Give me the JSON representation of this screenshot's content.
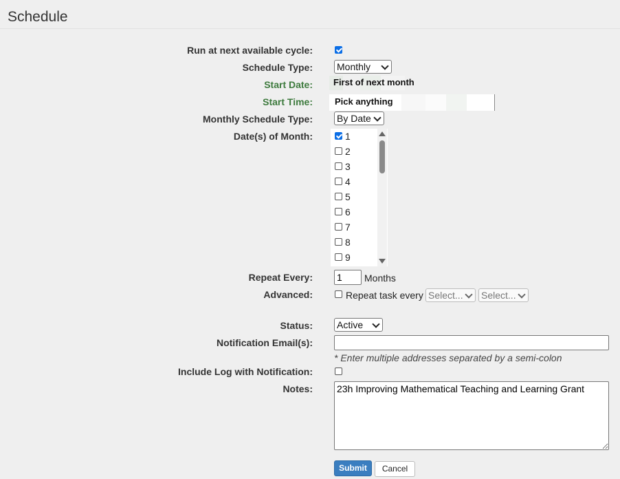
{
  "page": {
    "title": "Schedule"
  },
  "form": {
    "run_next": {
      "label": "Run at next available cycle:",
      "checked": true
    },
    "schedule_type": {
      "label": "Schedule Type:",
      "value": "Monthly"
    },
    "start_date": {
      "label": "Start Date:",
      "value": "First of next month"
    },
    "start_time": {
      "label": "Start Time:",
      "value": "Pick anything"
    },
    "monthly_schedule_type": {
      "label": "Monthly Schedule Type:",
      "value": "By Date"
    },
    "dates_of_month": {
      "label": "Date(s) of Month:",
      "items": [
        {
          "label": "1",
          "checked": true
        },
        {
          "label": "2",
          "checked": false
        },
        {
          "label": "3",
          "checked": false
        },
        {
          "label": "4",
          "checked": false
        },
        {
          "label": "5",
          "checked": false
        },
        {
          "label": "6",
          "checked": false
        },
        {
          "label": "7",
          "checked": false
        },
        {
          "label": "8",
          "checked": false
        },
        {
          "label": "9",
          "checked": false
        }
      ]
    },
    "repeat_every": {
      "label": "Repeat Every:",
      "value": "1",
      "unit": "Months"
    },
    "advanced": {
      "label": "Advanced:",
      "checkbox_label": "Repeat task every",
      "select1": "Select...",
      "select2": "Select..."
    },
    "status": {
      "label": "Status:",
      "value": "Active"
    },
    "notification_email": {
      "label": "Notification Email(s):",
      "value": "",
      "hint": "* Enter multiple addresses separated by a semi-colon"
    },
    "include_log": {
      "label": "Include Log with Notification:",
      "checked": false
    },
    "notes": {
      "label": "Notes:",
      "value": "23h Improving Mathematical Teaching and Learning Grant"
    }
  },
  "buttons": {
    "submit": "Submit",
    "cancel": "Cancel"
  },
  "colors": {
    "accent": "#3a7ec0",
    "checkbox": "#0b6ee6",
    "required_label": "#3d7a3d"
  }
}
